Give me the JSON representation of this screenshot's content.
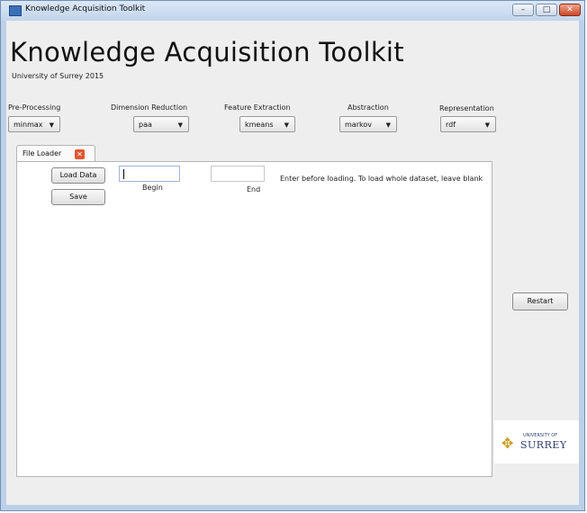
{
  "window": {
    "title": "Knowledge Acquisition Toolkit",
    "controls": {
      "minimize": "–",
      "maximize": "□",
      "close": "✕"
    }
  },
  "header": {
    "title": "Knowledge Acquisition Toolkit",
    "subtitle": "University of Surrey 2015"
  },
  "pipeline": [
    {
      "label": "Pre-Processing",
      "value": "minmax"
    },
    {
      "label": "Dimension Reduction",
      "value": "paa"
    },
    {
      "label": "Feature Extraction",
      "value": "kmeans"
    },
    {
      "label": "Abstraction",
      "value": "markov"
    },
    {
      "label": "Representation",
      "value": "rdf"
    }
  ],
  "tabs": [
    {
      "label": "File Loader",
      "close_icon": "close-icon"
    }
  ],
  "file_loader": {
    "load_button": "Load Data",
    "save_button": "Save",
    "begin_value": "",
    "begin_label": "Begin",
    "end_value": "",
    "end_label": "End",
    "hint": "Enter before loading. To load whole dataset, leave blank"
  },
  "side": {
    "restart_button": "Restart"
  },
  "logo": {
    "small_text": "UNIVERSITY OF",
    "big_text": "SURREY",
    "icon": "stag-icon"
  },
  "colors": {
    "window_frame": "#bcd0e8",
    "client_bg": "#eeeeee",
    "close_accent": "#e2572e"
  }
}
